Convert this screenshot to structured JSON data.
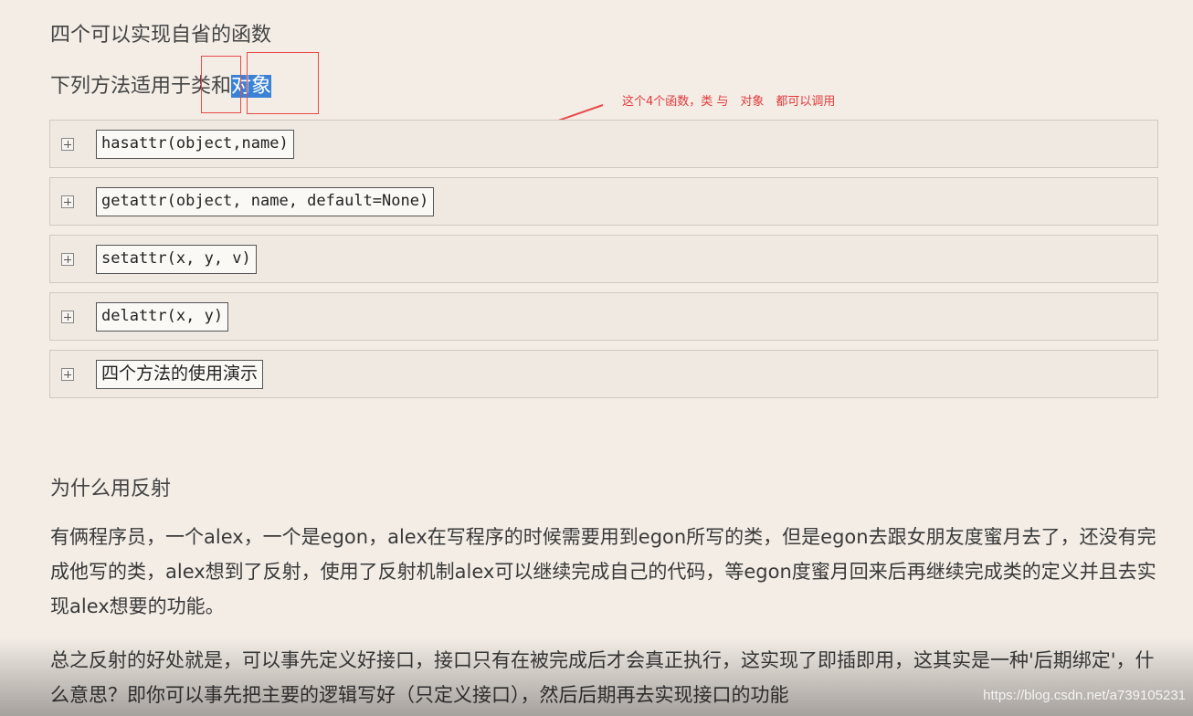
{
  "heading1": "四个可以实现自省的函数",
  "subline": {
    "prefix": "下列方法适用于",
    "class_word": "类",
    "and_word": "和",
    "object_word": "对象"
  },
  "annotation": "这个4个函数，类 与　对象　都可以调用",
  "panels": [
    {
      "code": "hasattr(object,name)"
    },
    {
      "code": "getattr(object, name, default=None)"
    },
    {
      "code": "setattr(x, y, v)"
    },
    {
      "code": "delattr(x, y)"
    },
    {
      "code": "四个方法的使用演示"
    }
  ],
  "heading2": "为什么用反射",
  "paragraphs": [
    "有俩程序员，一个alex，一个是egon，alex在写程序的时候需要用到egon所写的类，但是egon去跟女朋友度蜜月去了，还没有完成他写的类，alex想到了反射，使用了反射机制alex可以继续完成自己的代码，等egon度蜜月回来后再继续完成类的定义并且去实现alex想要的功能。",
    "总之反射的好处就是，可以事先定义好接口，接口只有在被完成后才会真正执行，这实现了即插即用，这其实是一种'后期绑定'，什么意思？即你可以事先把主要的逻辑写好（只定义接口），然后后期再去实现接口的功能"
  ],
  "watermark": "https://blog.csdn.net/a739105231",
  "colors": {
    "background": "#f3ede6",
    "highlight": "#3b82d6",
    "annotation_red": "#e84a4a"
  }
}
